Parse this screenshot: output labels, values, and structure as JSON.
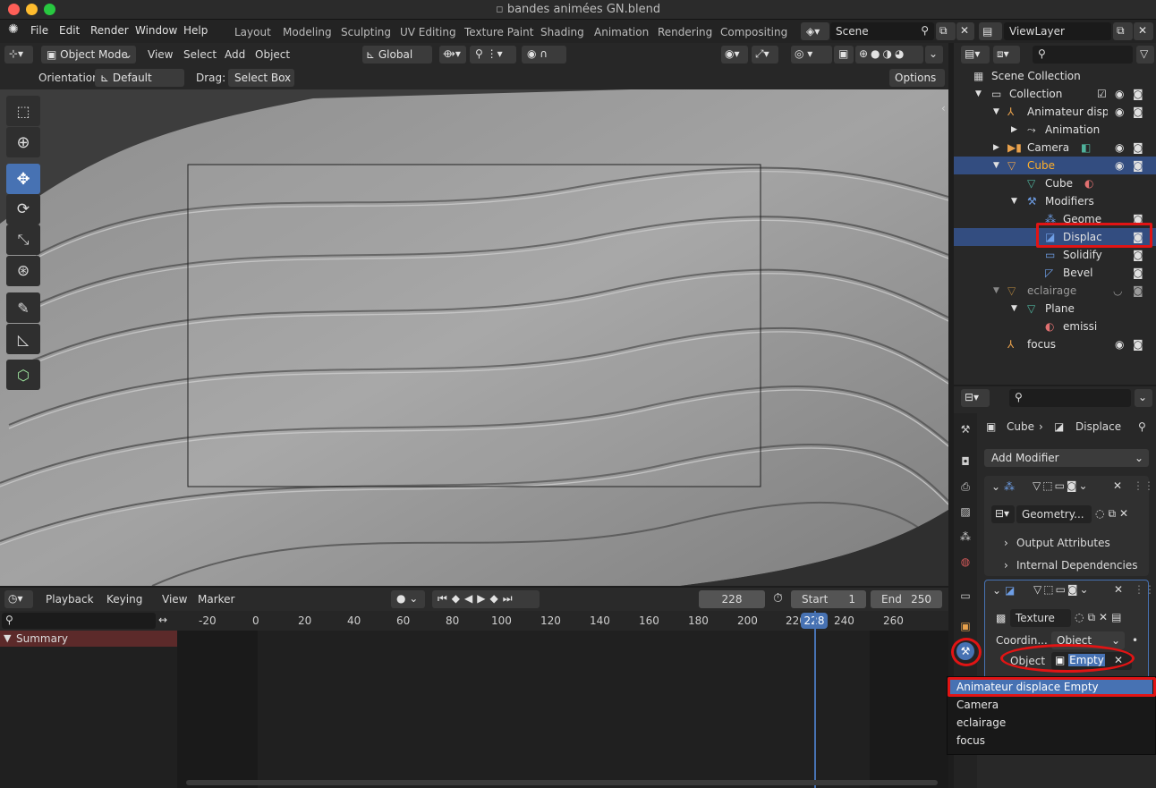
{
  "window": {
    "title": "bandes animées GN.blend"
  },
  "menubar": {
    "items": [
      "File",
      "Edit",
      "Render",
      "Window",
      "Help"
    ]
  },
  "workspaces": [
    "Layout",
    "Modeling",
    "Sculpting",
    "UV Editing",
    "Texture Paint",
    "Shading",
    "Animation",
    "Rendering",
    "Compositing"
  ],
  "scene": {
    "name": "Scene",
    "viewlayer": "ViewLayer"
  },
  "viewport_header": {
    "mode": "Object Mode",
    "menus": [
      "View",
      "Select",
      "Add",
      "Object"
    ],
    "transform": "Global",
    "orientation_label": "Orientation:",
    "orientation": "Default",
    "drag_label": "Drag:",
    "drag": "Select Box",
    "options": "Options"
  },
  "timeline": {
    "playback": "Playback",
    "keying": "Keying",
    "view": "View",
    "marker": "Marker",
    "current_frame": "228",
    "start_label": "Start",
    "start": "1",
    "end_label": "End",
    "end": "250",
    "ticks": [
      "-20",
      "0",
      "20",
      "40",
      "60",
      "80",
      "100",
      "120",
      "140",
      "160",
      "180",
      "200",
      "220",
      "240",
      "260"
    ],
    "playhead": "228",
    "summary": "Summary"
  },
  "outliner": {
    "items": [
      {
        "label": "Scene Collection",
        "indent": 0,
        "icon": "scene-collection-icon"
      },
      {
        "label": "Collection",
        "indent": 1,
        "icon": "collection-icon"
      },
      {
        "label": "Animateur disp",
        "indent": 2,
        "icon": "empty-icon"
      },
      {
        "label": "Animation",
        "indent": 3,
        "icon": "action-icon"
      },
      {
        "label": "Camera",
        "indent": 2,
        "icon": "camera-icon"
      },
      {
        "label": "Cube",
        "indent": 2,
        "icon": "mesh-object-icon"
      },
      {
        "label": "Cube",
        "indent": 3,
        "icon": "mesh-data-icon"
      },
      {
        "label": "Modifiers",
        "indent": 3,
        "icon": "wrench-icon"
      },
      {
        "label": "Geome",
        "indent": 4,
        "icon": "geometry-nodes-icon"
      },
      {
        "label": "Displac",
        "indent": 4,
        "icon": "displace-icon"
      },
      {
        "label": "Solidify",
        "indent": 4,
        "icon": "solidify-icon"
      },
      {
        "label": "Bevel",
        "indent": 4,
        "icon": "bevel-icon"
      },
      {
        "label": "eclairage",
        "indent": 2,
        "icon": "mesh-object-icon"
      },
      {
        "label": "Plane",
        "indent": 3,
        "icon": "mesh-data-icon"
      },
      {
        "label": "emissi",
        "indent": 4,
        "icon": "material-icon"
      },
      {
        "label": "focus",
        "indent": 2,
        "icon": "empty-icon"
      }
    ]
  },
  "properties": {
    "breadcrumb_object": "Cube",
    "breadcrumb_modifier": "Displace",
    "add_modifier": "Add Modifier",
    "geometry_nodes_name": "Geometry...",
    "output_attributes": "Output Attributes",
    "internal_dependencies": "Internal Dependencies",
    "texture_name": "Texture",
    "coordinates_label": "Coordin...",
    "coordinates_value": "Object",
    "object_label": "Object",
    "object_value": "Empty"
  },
  "dropdown": {
    "items": [
      "Animateur displace Empty",
      "Camera",
      "eclairage",
      "focus"
    ],
    "selected": "Animateur displace Empty"
  },
  "colors": {
    "accent": "#4772b3",
    "highlight": "#e11414",
    "object_orange": "#e8a14c"
  }
}
